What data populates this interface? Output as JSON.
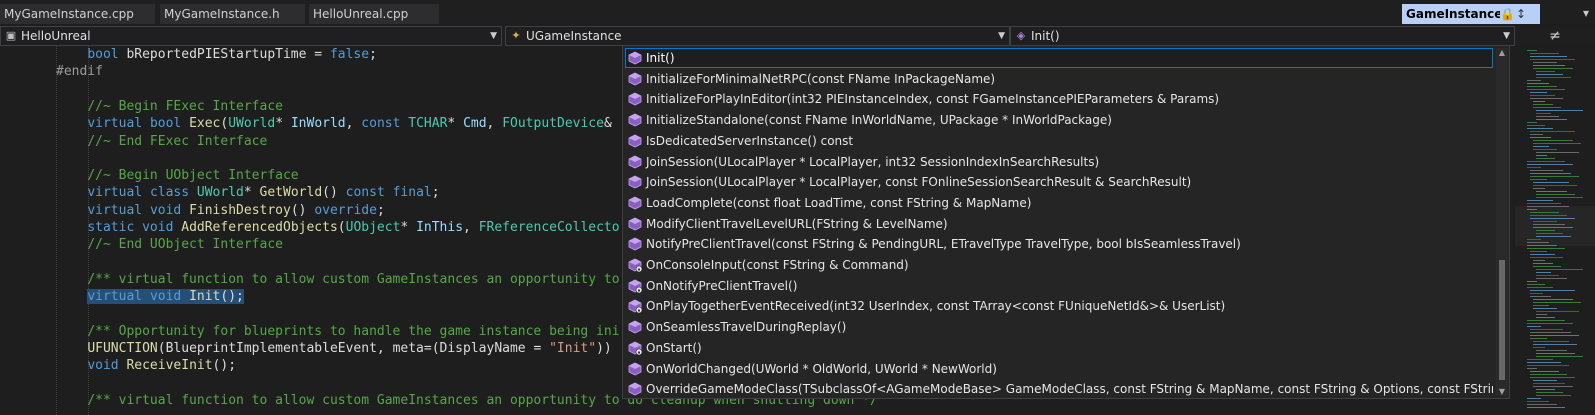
{
  "tabs": [
    {
      "label": "MyGameInstance.cpp",
      "active": false
    },
    {
      "label": "MyGameInstance.h",
      "active": false
    },
    {
      "label": "HelloUnreal.cpp",
      "active": false
    },
    {
      "label": "GameInstance.h",
      "active": true
    }
  ],
  "nav": {
    "project": "HelloUnreal",
    "scope": "UGameInstance",
    "member": "Init()"
  },
  "code_lines": [
    [
      [
        "",
        "    "
      ],
      [
        "kw",
        "bool"
      ],
      [
        "id",
        " bReportedPIEStartupTime = "
      ],
      [
        "kw",
        "false"
      ],
      [
        "id",
        ";"
      ]
    ],
    [
      [
        "pp",
        "#endif"
      ]
    ],
    [],
    [
      [
        "",
        "    "
      ],
      [
        "cm",
        "//~ Begin FExec Interface"
      ]
    ],
    [
      [
        "",
        "    "
      ],
      [
        "kw",
        "virtual"
      ],
      [
        "id",
        " "
      ],
      [
        "kw",
        "bool"
      ],
      [
        "id",
        " "
      ],
      [
        "fn",
        "Exec"
      ],
      [
        "id",
        "("
      ],
      [
        "ty",
        "UWorld"
      ],
      [
        "id",
        "* "
      ],
      [
        "pa",
        "InWorld"
      ],
      [
        "id",
        ", "
      ],
      [
        "kw",
        "const"
      ],
      [
        "id",
        " "
      ],
      [
        "ty",
        "TCHAR"
      ],
      [
        "id",
        "* "
      ],
      [
        "pa",
        "Cmd"
      ],
      [
        "id",
        ", "
      ],
      [
        "ty",
        "FOutputDevice"
      ],
      [
        "id",
        "&"
      ]
    ],
    [
      [
        "",
        "    "
      ],
      [
        "cm",
        "//~ End FExec Interface"
      ]
    ],
    [],
    [
      [
        "",
        "    "
      ],
      [
        "cm",
        "//~ Begin UObject Interface"
      ]
    ],
    [
      [
        "",
        "    "
      ],
      [
        "kw",
        "virtual"
      ],
      [
        "id",
        " "
      ],
      [
        "kw",
        "class"
      ],
      [
        "id",
        " "
      ],
      [
        "ty",
        "UWorld"
      ],
      [
        "id",
        "* "
      ],
      [
        "fn",
        "GetWorld"
      ],
      [
        "id",
        "() "
      ],
      [
        "kw",
        "const"
      ],
      [
        "id",
        " "
      ],
      [
        "kw",
        "final"
      ],
      [
        "id",
        ";"
      ]
    ],
    [
      [
        "",
        "    "
      ],
      [
        "kw",
        "virtual"
      ],
      [
        "id",
        " "
      ],
      [
        "kw",
        "void"
      ],
      [
        "id",
        " "
      ],
      [
        "fn",
        "FinishDestroy"
      ],
      [
        "id",
        "() "
      ],
      [
        "kw",
        "override"
      ],
      [
        "id",
        ";"
      ]
    ],
    [
      [
        "",
        "    "
      ],
      [
        "kw",
        "static"
      ],
      [
        "id",
        " "
      ],
      [
        "kw",
        "void"
      ],
      [
        "id",
        " "
      ],
      [
        "fn",
        "AddReferencedObjects"
      ],
      [
        "id",
        "("
      ],
      [
        "ty",
        "UObject"
      ],
      [
        "id",
        "* "
      ],
      [
        "pa",
        "InThis"
      ],
      [
        "id",
        ", "
      ],
      [
        "ty",
        "FReferenceCollecto"
      ]
    ],
    [
      [
        "",
        "    "
      ],
      [
        "cm",
        "//~ End UObject Interface"
      ]
    ],
    [],
    [
      [
        "",
        "    "
      ],
      [
        "cm",
        "/** virtual function to allow custom GameInstances an opportunity to"
      ]
    ],
    [
      [
        "",
        "    "
      ],
      [
        "kw",
        "virtual"
      ],
      [
        "id",
        " "
      ],
      [
        "kw",
        "void"
      ],
      [
        "id",
        " "
      ],
      [
        "fn",
        "Init"
      ],
      [
        "id",
        "();"
      ]
    ],
    [],
    [
      [
        "",
        "    "
      ],
      [
        "cm",
        "/** Opportunity for blueprints to handle the game instance being ini"
      ]
    ],
    [
      [
        "",
        "    "
      ],
      [
        "fn",
        "UFUNCTION"
      ],
      [
        "id",
        "("
      ],
      [
        "id",
        "BlueprintImplementableEvent, meta=(DisplayName = "
      ],
      [
        "st",
        "\"Init\""
      ],
      [
        "id",
        "))"
      ]
    ],
    [
      [
        "",
        "    "
      ],
      [
        "kw",
        "void"
      ],
      [
        "id",
        " "
      ],
      [
        "fn",
        "ReceiveInit"
      ],
      [
        "id",
        "();"
      ]
    ],
    [],
    [
      [
        "",
        "    "
      ],
      [
        "cm",
        "/** virtual function to allow custom GameInstances an opportunity to do cleanup when shutting down */"
      ]
    ]
  ],
  "completion": {
    "items": [
      {
        "label": "Init()",
        "icon": "method-icon"
      },
      {
        "label": "InitializeForMinimalNetRPC(const FName InPackageName)",
        "icon": "method-icon"
      },
      {
        "label": "InitializeForPlayInEditor(int32 PIEInstanceIndex, const FGameInstancePIEParameters & Params)",
        "icon": "method-icon"
      },
      {
        "label": "InitializeStandalone(const FName InWorldName, UPackage * InWorldPackage)",
        "icon": "method-icon"
      },
      {
        "label": "IsDedicatedServerInstance() const",
        "icon": "method-icon"
      },
      {
        "label": "JoinSession(ULocalPlayer * LocalPlayer, int32 SessionIndexInSearchResults)",
        "icon": "method-icon"
      },
      {
        "label": "JoinSession(ULocalPlayer * LocalPlayer, const FOnlineSessionSearchResult & SearchResult)",
        "icon": "method-icon"
      },
      {
        "label": "LoadComplete(const float LoadTime, const FString & MapName)",
        "icon": "method-icon"
      },
      {
        "label": "ModifyClientTravelLevelURL(FString & LevelName)",
        "icon": "method-icon"
      },
      {
        "label": "NotifyPreClientTravel(const FString & PendingURL, ETravelType TravelType, bool bIsSeamlessTravel)",
        "icon": "method-icon"
      },
      {
        "label": "OnConsoleInput(const FString & Command)",
        "icon": "protected-method-icon"
      },
      {
        "label": "OnNotifyPreClientTravel()",
        "icon": "protected-method-icon"
      },
      {
        "label": "OnPlayTogetherEventReceived(int32 UserIndex, const TArray<const FUniqueNetId&>& UserList)",
        "icon": "protected-method-icon"
      },
      {
        "label": "OnSeamlessTravelDuringReplay()",
        "icon": "method-icon"
      },
      {
        "label": "OnStart()",
        "icon": "protected-method-icon"
      },
      {
        "label": "OnWorldChanged(UWorld * OldWorld, UWorld * NewWorld)",
        "icon": "method-icon"
      },
      {
        "label": "OverrideGameModeClass(TSubclassOf<AGameModeBase> GameModeClass, const FString & MapName, const FString & Options, const FString & Portal) const",
        "icon": "method-icon"
      }
    ]
  },
  "colors": {
    "keyword": "#569cd6",
    "type": "#4ec9b0",
    "function": "#dcdcaa",
    "comment": "#57a64a",
    "string": "#d69d85",
    "method_icon": "#b180d7",
    "active_tab": "#b8d0f5"
  }
}
